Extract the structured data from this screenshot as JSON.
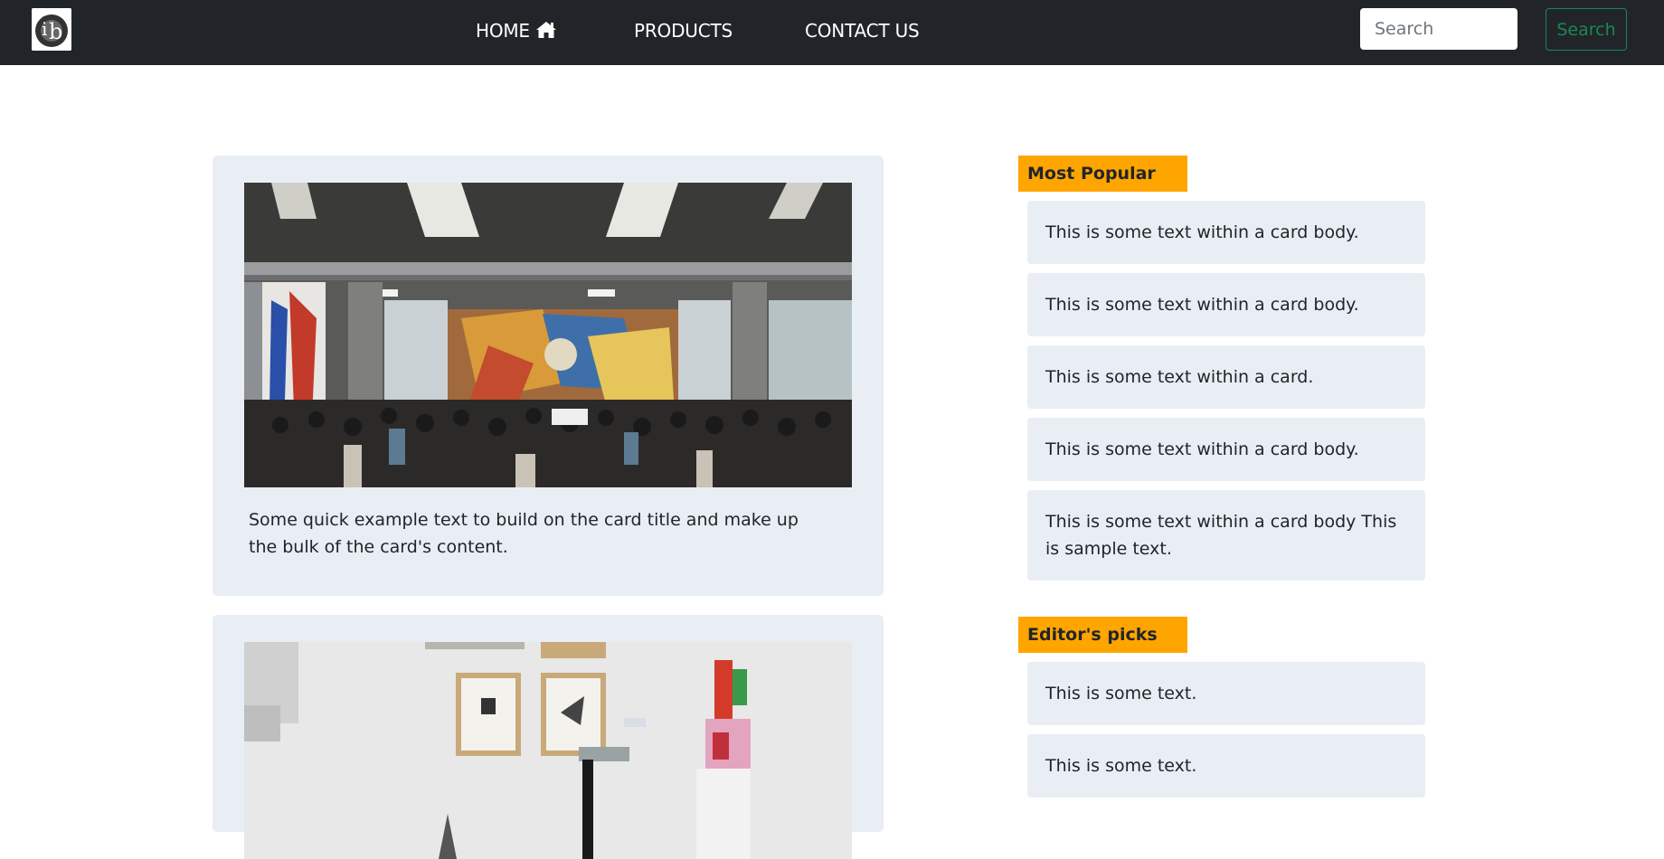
{
  "navbar": {
    "logo_alt": "ib",
    "links": [
      {
        "label": "HOME",
        "icon": "home-icon"
      },
      {
        "label": "PRODUCTS"
      },
      {
        "label": "CONTACT US"
      }
    ],
    "search_placeholder": "Search",
    "search_button": "Search",
    "search_button_color": "#198754",
    "background": "#212529"
  },
  "main": {
    "cards": [
      {
        "text": "Some quick example text to build on the card title and make up the bulk of the card's content.",
        "image": "photo of crowd in hall with colorful mural"
      },
      {
        "image": "photo of gallery room with framed pictures and sculpture"
      }
    ]
  },
  "sidebar": {
    "heading_color": "#ffa500",
    "most_popular": {
      "title": "Most Popular",
      "items": [
        "This is some text within a card body.",
        "This is some text within a card body.",
        "This is some text within a card.",
        "This is some text within a card body.",
        "This is some text within a card body This is sample text."
      ]
    },
    "editors_picks": {
      "title": "Editor's picks",
      "items": [
        "This is some text.",
        "This is some text."
      ]
    }
  }
}
